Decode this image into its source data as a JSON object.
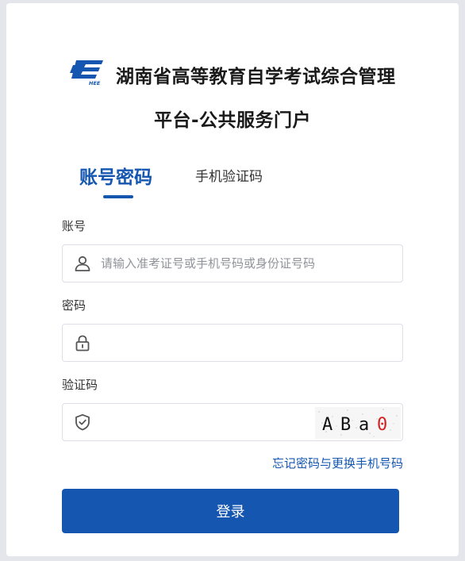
{
  "header": {
    "logo_text": "HEE",
    "title_line1": "湖南省高等教育自学考试综合管理",
    "title_line2": "平台-公共服务门户"
  },
  "tabs": [
    {
      "label": "账号密码",
      "active": true
    },
    {
      "label": "手机验证码",
      "active": false
    }
  ],
  "form": {
    "account": {
      "label": "账号",
      "value": "",
      "placeholder": "请输入准考证号或手机号码或身份证号码",
      "icon": "user-icon"
    },
    "password": {
      "label": "密码",
      "value": "",
      "placeholder": "",
      "icon": "lock-icon"
    },
    "captcha": {
      "label": "验证码",
      "value": "",
      "placeholder": "",
      "icon": "shield-check-icon",
      "image_chars": [
        "A",
        "B",
        "a",
        "0"
      ],
      "image_char_colors": [
        "#111111",
        "#111111",
        "#111111",
        "#d42020"
      ]
    },
    "forgot_link": "忘记密码与更换手机号码",
    "login_button": "登录"
  },
  "colors": {
    "primary": "#1557b0",
    "background": "#e4e6eb",
    "card": "#ffffff",
    "captcha_red": "#d42020"
  }
}
